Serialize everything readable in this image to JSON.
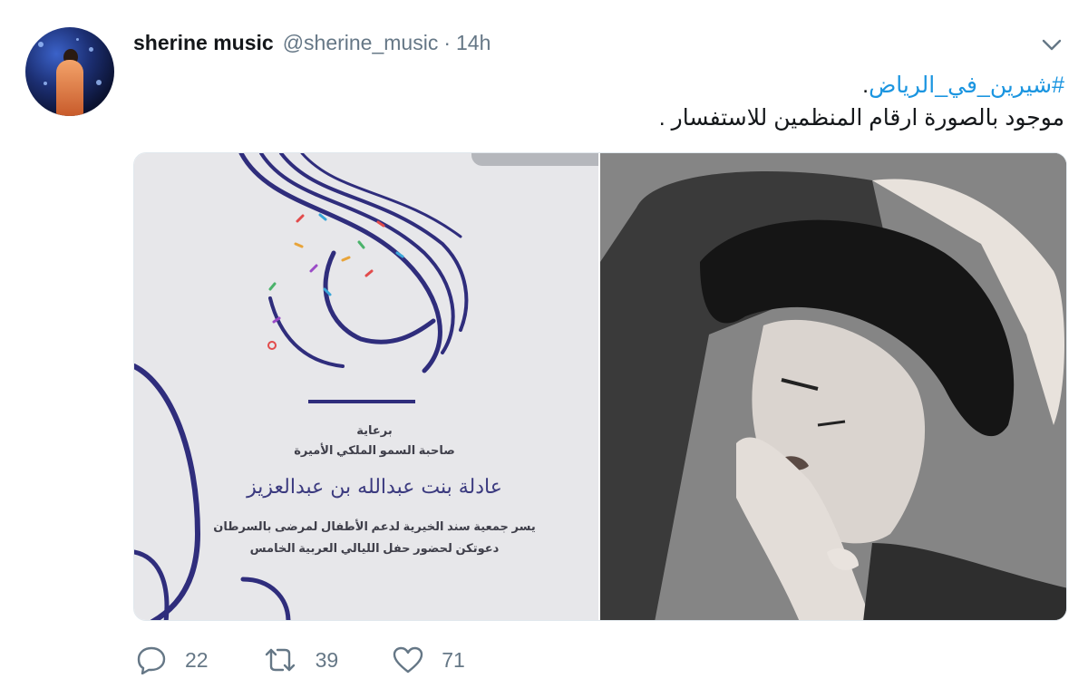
{
  "tweet": {
    "display_name": "sherine music",
    "handle": "@sherine_music",
    "separator": "·",
    "time": "14h",
    "hashtag": "#شيرين_في_الرياض",
    "hashtag_suffix": ".",
    "body_line2": "موجود بالصورة ارقام المنظمين للاستفسار ."
  },
  "media": {
    "card_text": {
      "sponsor": "برعاية",
      "princess_title": "صاحبة السمو الملكي الأميرة",
      "princess_name": "عادلة بنت عبدالله بن عبدالعزيز",
      "invite_line1": "يسر جمعية سند الخيرية لدعم الأطفال لمرضى بالسرطان",
      "invite_line2": "دعوتكن لحضور حفل الليالي العربية الخامس"
    }
  },
  "actions": {
    "reply_count": "22",
    "retweet_count": "39",
    "like_count": "71"
  },
  "icons": {
    "reply": "reply-icon",
    "retweet": "retweet-icon",
    "like": "heart-icon",
    "menu": "chevron-down-icon"
  },
  "colors": {
    "hashtag": "#1b95e0",
    "muted": "#657786",
    "calligraphy": "#2f2d7c"
  }
}
